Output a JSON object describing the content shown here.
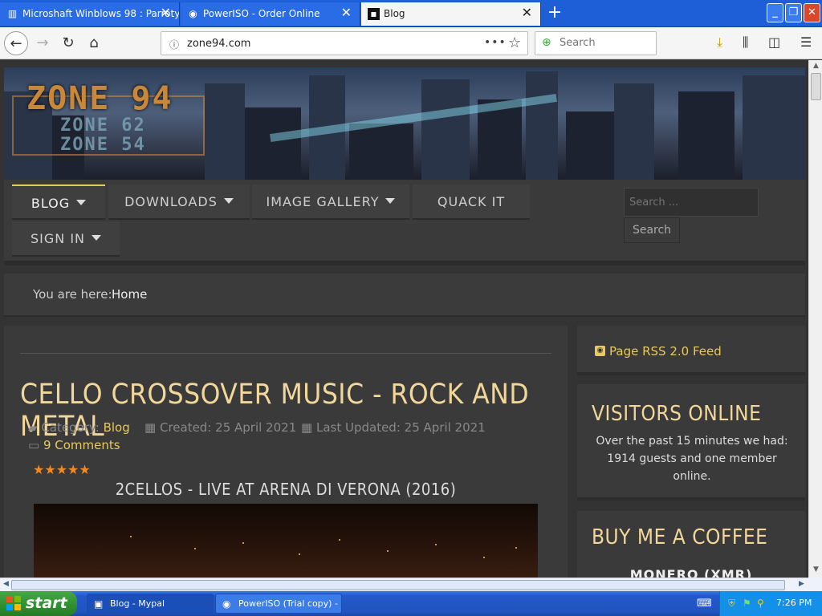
{
  "browser": {
    "tabs": [
      {
        "title": "Microshaft Winblows 98 : Parroty",
        "icon": "site-icon"
      },
      {
        "title": "PowerISO - Order Online",
        "icon": "disc-icon"
      },
      {
        "title": "Blog",
        "icon": "site-icon"
      }
    ],
    "address": "zone94.com",
    "search_placeholder": "Search"
  },
  "site": {
    "logo": {
      "main": "ZONE 94",
      "line2": "ZONE 62",
      "line3": "ZONE 54"
    },
    "menu": [
      {
        "label": "BLOG"
      },
      {
        "label": "DOWNLOADS"
      },
      {
        "label": "IMAGE GALLERY"
      },
      {
        "label": "QUACK IT"
      },
      {
        "label": "SIGN IN"
      }
    ],
    "search_placeholder": "Search ...",
    "search_button": "Search",
    "breadcrumb": {
      "label": "You are here:",
      "current": "Home"
    }
  },
  "article": {
    "title": "CELLO CROSSOVER MUSIC - ROCK AND METAL",
    "category_label": "Category:",
    "category": "Blog",
    "created": "Created: 25 April 2021",
    "updated": "Last Updated: 25 April 2021",
    "comments": "9 Comments",
    "rating": "★★★★★",
    "rating_value": 5,
    "video_title": "2CELLOS - LIVE AT ARENA DI VERONA (2016)"
  },
  "sidebar": {
    "rss": "Page RSS 2.0 Feed",
    "visitors_title": "VISITORS ONLINE",
    "visitors_text": "Over the past 15 minutes we had: 1914 guests and one member online.",
    "coffee_title": "BUY ME A COFFEE",
    "coffee_sub": "MONERO (XMR)"
  },
  "taskbar": {
    "start": "start",
    "tasks": [
      {
        "label": "Blog - Mypal"
      },
      {
        "label": "PowerISO (Trial copy) -"
      }
    ],
    "clock": "7:26 PM"
  },
  "colors": {
    "accent": "#e8c95a",
    "title": "#f2d79a",
    "stars": "#f08a24",
    "taskbar": "#2154c0",
    "tab_bar": "#1e5fd8"
  }
}
